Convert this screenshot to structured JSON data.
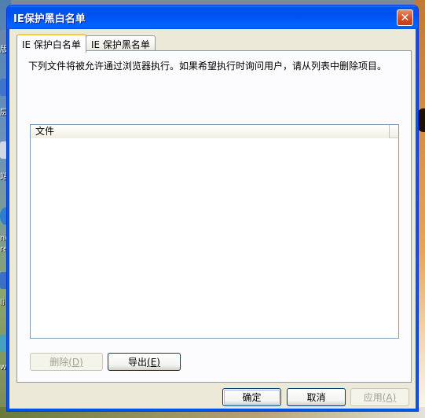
{
  "window": {
    "title": "IE保护黑白名单",
    "close_glyph": "✕"
  },
  "tabs": [
    {
      "label": "IE 保护白名单",
      "active": true
    },
    {
      "label": "IE 保护黑名单",
      "active": false
    }
  ],
  "whitelist": {
    "description": "下列文件将被允许通过浏览器执行。如果希望执行时询问用户，请从列表中删除项目。",
    "list_header": "文件",
    "rows": []
  },
  "buttons": {
    "delete": {
      "label": "删除",
      "accel": "(D)",
      "enabled": false
    },
    "export": {
      "label": "导出",
      "accel": "(E)",
      "enabled": true
    },
    "ok": "确定",
    "cancel": "取消",
    "apply": {
      "label": "应用",
      "accel": "(A)",
      "enabled": false
    }
  },
  "desktop": {
    "left_icon_labels": [
      "版",
      "层",
      "站",
      "ne",
      "re",
      "li",
      "ws"
    ]
  },
  "colors": {
    "titlebar": "#0055E5",
    "window_bg": "#ECE9D8",
    "panel_bg": "#FCFCFE",
    "active_tab_accent": "#FFC83C"
  }
}
